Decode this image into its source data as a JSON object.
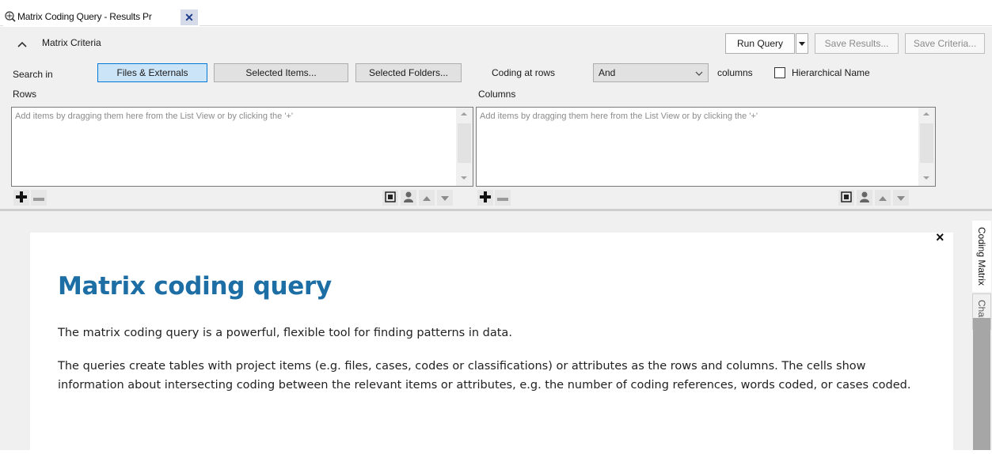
{
  "tab": {
    "title": "Matrix Coding Query - Results Pr",
    "close_glyph": "✕",
    "icon": "matrix-query-icon"
  },
  "criteria": {
    "title": "Matrix Criteria",
    "run_query": "Run Query",
    "save_results": "Save Results...",
    "save_criteria": "Save Criteria...",
    "search_in_label": "Search in",
    "search_options": [
      "Files & Externals",
      "Selected Items...",
      "Selected Folders..."
    ],
    "coding_at_rows_label": "Coding at rows",
    "operator_value": "And",
    "columns_label": "columns",
    "hierarchical_name_label": "Hierarchical Name",
    "hierarchical_name_checked": false,
    "rows_label": "Rows",
    "columns_section_label": "Columns",
    "rows_placeholder": "Add items by dragging them here from the List View or by clicking the '+'",
    "columns_placeholder": "Add items by dragging them here from the List View or by clicking the '+'"
  },
  "help": {
    "heading": "Matrix coding query",
    "para1": "The matrix coding query is a powerful, flexible tool for finding patterns in data.",
    "para2": "The queries create tables with project items (e.g. files, cases, codes or classifications) or attributes as the rows and columns. The cells show information about intersecting coding between the relevant items or attributes, e.g. the number of coding references, words coded, or cases coded.",
    "close_glyph": "×"
  },
  "side_tabs": [
    "Coding Matrix",
    "Chart"
  ],
  "colors": {
    "heading": "#1c6ea4",
    "active_button": "#cce4f7",
    "accent_border": "#0078d4"
  }
}
